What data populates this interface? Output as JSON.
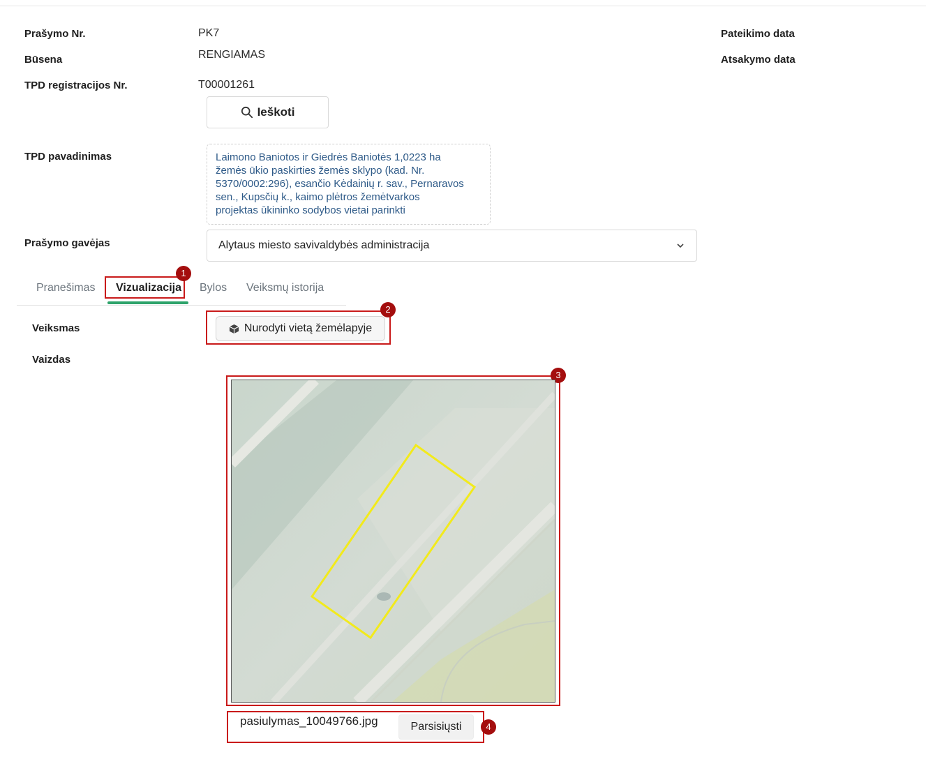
{
  "form": {
    "prasymo_nr": {
      "label": "Prašymo Nr.",
      "value": "PK7"
    },
    "busena": {
      "label": "Būsena",
      "value": "RENGIAMAS"
    },
    "tpd_reg": {
      "label": "TPD registracijos Nr.",
      "value": "T00001261"
    },
    "search_button": "Ieškoti",
    "tpd_name": {
      "label": "TPD pavadinimas",
      "lines": [
        "Laimono Baniotos ir Giedrės Baniotės 1,0223 ha",
        "žemės ūkio paskirties žemės sklypo (kad. Nr.",
        "5370/0002:296), esančio Kėdainių r. sav., Pernaravos",
        "sen., Kupsčių k., kaimo plėtros žemėtvarkos",
        "projektas ūkininko sodybos  vietai parinkti"
      ]
    },
    "recipient": {
      "label": "Prašymo gavėjas",
      "value": "Alytaus miesto savivaldybės administracija"
    },
    "pateikimo_data": {
      "label": "Pateikimo data"
    },
    "atsakymo_data": {
      "label": "Atsakymo data"
    }
  },
  "tabs": [
    {
      "label": "Pranešimas",
      "active": false
    },
    {
      "label": "Vizualizacija",
      "active": true
    },
    {
      "label": "Bylos",
      "active": false
    },
    {
      "label": "Veiksmų istorija",
      "active": false
    }
  ],
  "visualization": {
    "action_label": "Veiksmas",
    "action_button": "Nurodyti vietą žemėlapyje",
    "view_label": "Vaizdas",
    "file_name": "pasiulymas_10049766.jpg",
    "download_button": "Parsisiųsti"
  },
  "annotations": [
    "1",
    "2",
    "3",
    "4"
  ],
  "colors": {
    "highlight": "#c91a1a",
    "badge": "#a40e0e",
    "tab_accent": "#2ea36b",
    "tpd_text": "#2e5a88",
    "polygon": "#f2ea1c"
  },
  "icons": {
    "search": "search-icon",
    "chevron": "chevron-down-icon",
    "map_marker": "cube-icon"
  }
}
